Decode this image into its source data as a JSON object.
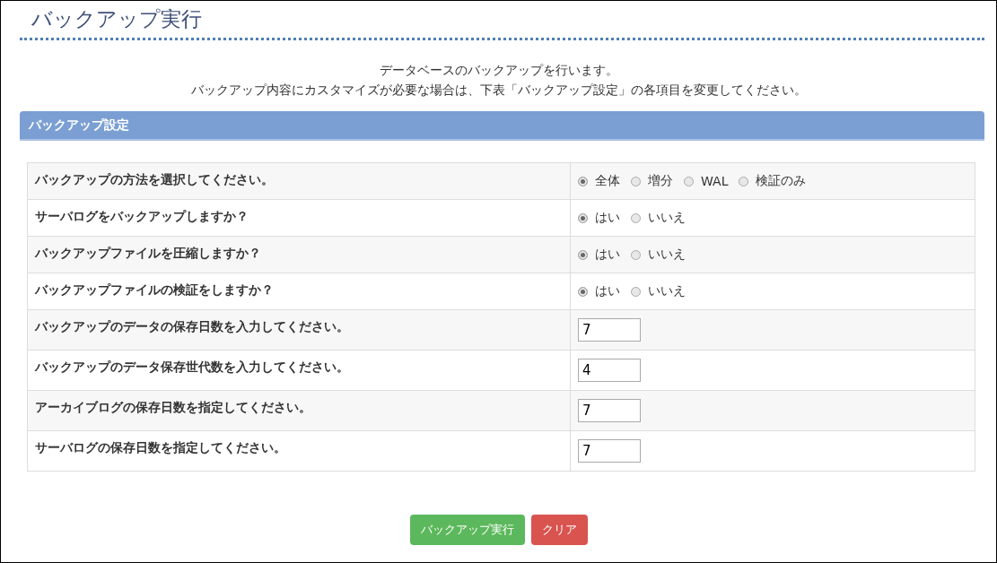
{
  "page_title": "バックアップ実行",
  "intro": [
    "データベースのバックアップを行います。",
    "バックアップ内容にカスタマイズが必要な場合は、下表「バックアップ設定」の各項目を変更してください。"
  ],
  "section": {
    "title": "バックアップ設定"
  },
  "rows": [
    {
      "kind": "radio",
      "label": "バックアップの方法を選択してください。",
      "options": [
        {
          "label": "全体",
          "selected": true
        },
        {
          "label": "増分",
          "selected": false
        },
        {
          "label": "WAL",
          "selected": false
        },
        {
          "label": "検証のみ",
          "selected": false
        }
      ]
    },
    {
      "kind": "radio",
      "label": "サーバログをバックアップしますか？",
      "options": [
        {
          "label": "はい",
          "selected": true
        },
        {
          "label": "いいえ",
          "selected": false
        }
      ]
    },
    {
      "kind": "radio",
      "label": "バックアップファイルを圧縮しますか？",
      "options": [
        {
          "label": "はい",
          "selected": true
        },
        {
          "label": "いいえ",
          "selected": false
        }
      ]
    },
    {
      "kind": "radio",
      "label": "バックアップファイルの検証をしますか？",
      "options": [
        {
          "label": "はい",
          "selected": true
        },
        {
          "label": "いいえ",
          "selected": false
        }
      ]
    },
    {
      "kind": "number",
      "label": "バックアップのデータの保存日数を入力してください。",
      "value": "7"
    },
    {
      "kind": "number",
      "label": "バックアップのデータ保存世代数を入力してください。",
      "value": "4"
    },
    {
      "kind": "number",
      "label": "アーカイブログの保存日数を指定してください。",
      "value": "7"
    },
    {
      "kind": "number",
      "label": "サーバログの保存日数を指定してください。",
      "value": "7"
    }
  ],
  "buttons": [
    {
      "label": "バックアップ実行",
      "kind": "primary"
    },
    {
      "label": "クリア",
      "kind": "danger"
    }
  ]
}
